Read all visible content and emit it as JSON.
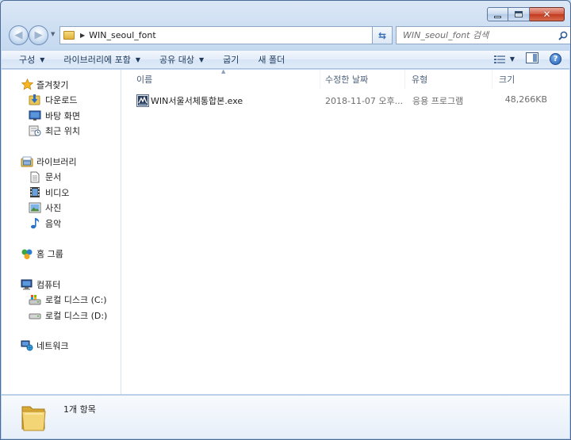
{
  "window": {
    "address": "WIN_seoul_font"
  },
  "search": {
    "placeholder": "WIN_seoul_font 검색"
  },
  "toolbar": {
    "organize": "구성",
    "include_library": "라이브러리에 포함",
    "share": "공유 대상",
    "burn": "굽기",
    "new_folder": "새 폴더"
  },
  "sidebar": {
    "favorites": {
      "label": "즐겨찾기",
      "items": [
        "다운로드",
        "바탕 화면",
        "최근 위치"
      ]
    },
    "libraries": {
      "label": "라이브러리",
      "items": [
        "문서",
        "비디오",
        "사진",
        "음악"
      ]
    },
    "homegroup": {
      "label": "홈 그룹"
    },
    "computer": {
      "label": "컴퓨터",
      "items": [
        "로컬 디스크 (C:)",
        "로컬 디스크 (D:)"
      ]
    },
    "network": {
      "label": "네트워크"
    }
  },
  "columns": {
    "name": "이름",
    "date": "수정한 날짜",
    "type": "유형",
    "size": "크기"
  },
  "files": [
    {
      "name": "WIN서울서체통합본.exe",
      "date": "2018-11-07 오후...",
      "type": "응용 프로그램",
      "size": "48,266KB"
    }
  ],
  "details": {
    "count": "1개 항목"
  },
  "colors": {
    "accent": "#1e395b",
    "frame": "#c5d9f0",
    "close": "#c13a1f"
  }
}
